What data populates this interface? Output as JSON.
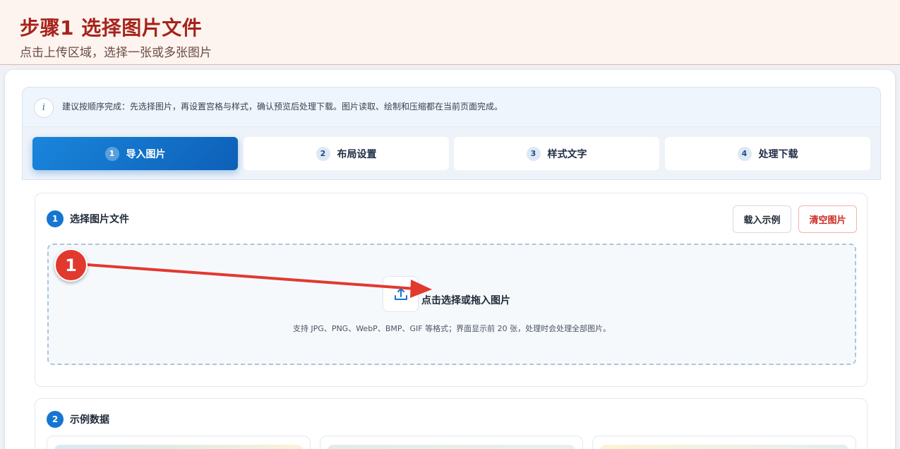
{
  "guide": {
    "title": "步骤1 选择图片文件",
    "subtitle": "点击上传区域，选择一张或多张图片"
  },
  "tip": {
    "icon": "info-icon",
    "icon_glyph": "i",
    "text": "建议按顺序完成：先选择图片，再设置宫格与样式，确认预览后处理下载。图片读取、绘制和压缩都在当前页面完成。"
  },
  "tabs": [
    {
      "num": "1",
      "label": "导入图片",
      "active": true
    },
    {
      "num": "2",
      "label": "布局设置",
      "active": false
    },
    {
      "num": "3",
      "label": "样式文字",
      "active": false
    },
    {
      "num": "4",
      "label": "处理下载",
      "active": false
    }
  ],
  "select_section": {
    "badge": "1",
    "title": "选择图片文件",
    "load_sample_label": "载入示例",
    "clear_label": "清空图片",
    "dropzone": {
      "icon": "upload-icon",
      "title": "点击选择或拖入图片",
      "note": "支持 JPG、PNG、WebP、BMP、GIF 等格式；界面显示前 20 张，处理时会处理全部图片。"
    }
  },
  "sample_section": {
    "badge": "2",
    "title": "示例数据"
  },
  "annotation": {
    "marker": "1",
    "color": "#e2392f"
  },
  "colors": {
    "accent": "#1675d1",
    "guide_title": "#a6241b",
    "danger": "#cc2a20"
  }
}
